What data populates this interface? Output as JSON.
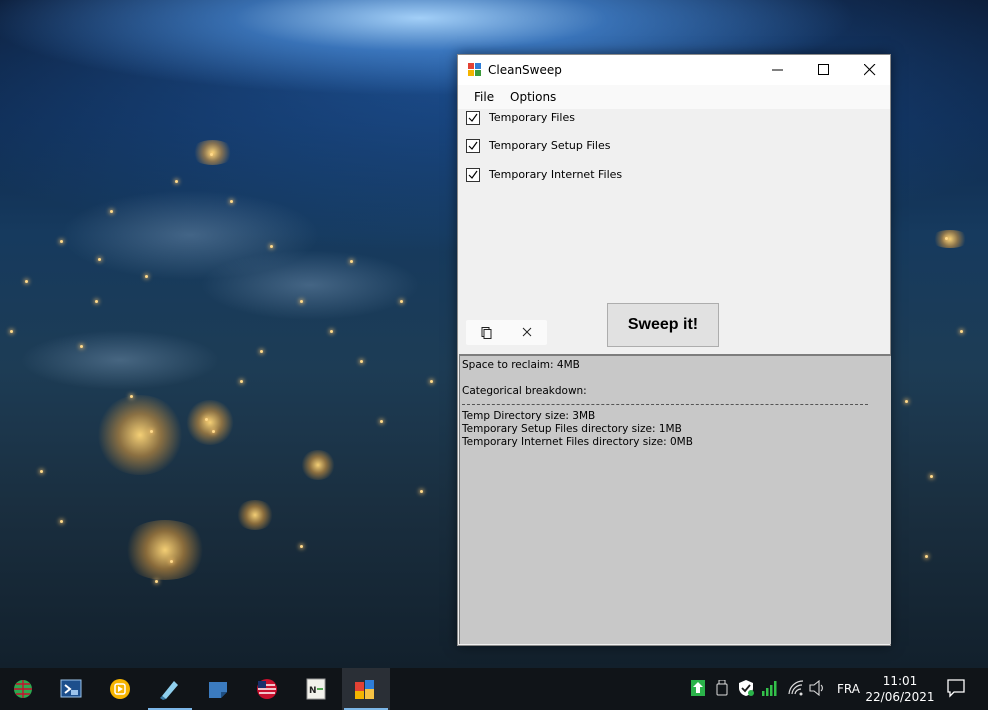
{
  "window": {
    "title": "CleanSweep",
    "menu": [
      "File",
      "Options"
    ],
    "checkboxes": [
      {
        "label": "Temporary Files",
        "checked": true
      },
      {
        "label": "Temporary Setup Files",
        "checked": true
      },
      {
        "label": "Temporary Internet Files",
        "checked": true
      }
    ],
    "sweep_button": "Sweep it!",
    "output": {
      "space_line": "Space to reclaim: 4MB",
      "breakdown_heading": "Categorical breakdown:",
      "lines": [
        "Temp Directory size: 3MB",
        "Temporary Setup Files directory size: 1MB",
        "Temporary Internet Files directory size: 0MB"
      ]
    }
  },
  "taskbar": {
    "apps": [
      {
        "name": "globe-app-icon"
      },
      {
        "name": "remote-desktop-icon"
      },
      {
        "name": "media-player-icon"
      },
      {
        "name": "notepad-pen-icon"
      },
      {
        "name": "sticky-notes-icon"
      },
      {
        "name": "flag-app-icon"
      },
      {
        "name": "notepadpp-icon"
      },
      {
        "name": "cleansweep-icon",
        "active": true
      }
    ],
    "language": "FRA",
    "time": "11:01",
    "date": "22/06/2021"
  },
  "colors": {
    "accent": "#7cb7e8",
    "output_bg": "#c8c8c8",
    "taskbar_bg": "#101418"
  }
}
